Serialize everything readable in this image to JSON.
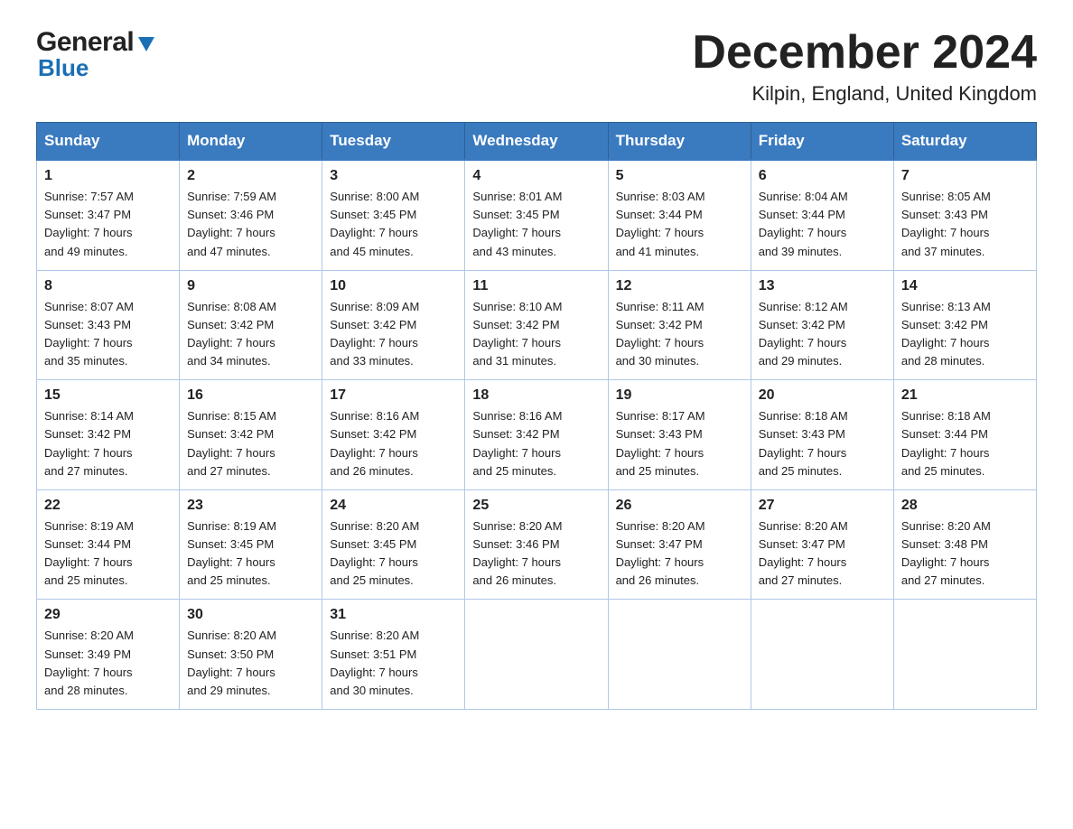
{
  "header": {
    "logo_general": "General",
    "logo_blue": "Blue",
    "title": "December 2024",
    "subtitle": "Kilpin, England, United Kingdom"
  },
  "days_of_week": [
    "Sunday",
    "Monday",
    "Tuesday",
    "Wednesday",
    "Thursday",
    "Friday",
    "Saturday"
  ],
  "weeks": [
    [
      {
        "num": "1",
        "sunrise": "7:57 AM",
        "sunset": "3:47 PM",
        "daylight": "7 hours and 49 minutes."
      },
      {
        "num": "2",
        "sunrise": "7:59 AM",
        "sunset": "3:46 PM",
        "daylight": "7 hours and 47 minutes."
      },
      {
        "num": "3",
        "sunrise": "8:00 AM",
        "sunset": "3:45 PM",
        "daylight": "7 hours and 45 minutes."
      },
      {
        "num": "4",
        "sunrise": "8:01 AM",
        "sunset": "3:45 PM",
        "daylight": "7 hours and 43 minutes."
      },
      {
        "num": "5",
        "sunrise": "8:03 AM",
        "sunset": "3:44 PM",
        "daylight": "7 hours and 41 minutes."
      },
      {
        "num": "6",
        "sunrise": "8:04 AM",
        "sunset": "3:44 PM",
        "daylight": "7 hours and 39 minutes."
      },
      {
        "num": "7",
        "sunrise": "8:05 AM",
        "sunset": "3:43 PM",
        "daylight": "7 hours and 37 minutes."
      }
    ],
    [
      {
        "num": "8",
        "sunrise": "8:07 AM",
        "sunset": "3:43 PM",
        "daylight": "7 hours and 35 minutes."
      },
      {
        "num": "9",
        "sunrise": "8:08 AM",
        "sunset": "3:42 PM",
        "daylight": "7 hours and 34 minutes."
      },
      {
        "num": "10",
        "sunrise": "8:09 AM",
        "sunset": "3:42 PM",
        "daylight": "7 hours and 33 minutes."
      },
      {
        "num": "11",
        "sunrise": "8:10 AM",
        "sunset": "3:42 PM",
        "daylight": "7 hours and 31 minutes."
      },
      {
        "num": "12",
        "sunrise": "8:11 AM",
        "sunset": "3:42 PM",
        "daylight": "7 hours and 30 minutes."
      },
      {
        "num": "13",
        "sunrise": "8:12 AM",
        "sunset": "3:42 PM",
        "daylight": "7 hours and 29 minutes."
      },
      {
        "num": "14",
        "sunrise": "8:13 AM",
        "sunset": "3:42 PM",
        "daylight": "7 hours and 28 minutes."
      }
    ],
    [
      {
        "num": "15",
        "sunrise": "8:14 AM",
        "sunset": "3:42 PM",
        "daylight": "7 hours and 27 minutes."
      },
      {
        "num": "16",
        "sunrise": "8:15 AM",
        "sunset": "3:42 PM",
        "daylight": "7 hours and 27 minutes."
      },
      {
        "num": "17",
        "sunrise": "8:16 AM",
        "sunset": "3:42 PM",
        "daylight": "7 hours and 26 minutes."
      },
      {
        "num": "18",
        "sunrise": "8:16 AM",
        "sunset": "3:42 PM",
        "daylight": "7 hours and 25 minutes."
      },
      {
        "num": "19",
        "sunrise": "8:17 AM",
        "sunset": "3:43 PM",
        "daylight": "7 hours and 25 minutes."
      },
      {
        "num": "20",
        "sunrise": "8:18 AM",
        "sunset": "3:43 PM",
        "daylight": "7 hours and 25 minutes."
      },
      {
        "num": "21",
        "sunrise": "8:18 AM",
        "sunset": "3:44 PM",
        "daylight": "7 hours and 25 minutes."
      }
    ],
    [
      {
        "num": "22",
        "sunrise": "8:19 AM",
        "sunset": "3:44 PM",
        "daylight": "7 hours and 25 minutes."
      },
      {
        "num": "23",
        "sunrise": "8:19 AM",
        "sunset": "3:45 PM",
        "daylight": "7 hours and 25 minutes."
      },
      {
        "num": "24",
        "sunrise": "8:20 AM",
        "sunset": "3:45 PM",
        "daylight": "7 hours and 25 minutes."
      },
      {
        "num": "25",
        "sunrise": "8:20 AM",
        "sunset": "3:46 PM",
        "daylight": "7 hours and 26 minutes."
      },
      {
        "num": "26",
        "sunrise": "8:20 AM",
        "sunset": "3:47 PM",
        "daylight": "7 hours and 26 minutes."
      },
      {
        "num": "27",
        "sunrise": "8:20 AM",
        "sunset": "3:47 PM",
        "daylight": "7 hours and 27 minutes."
      },
      {
        "num": "28",
        "sunrise": "8:20 AM",
        "sunset": "3:48 PM",
        "daylight": "7 hours and 27 minutes."
      }
    ],
    [
      {
        "num": "29",
        "sunrise": "8:20 AM",
        "sunset": "3:49 PM",
        "daylight": "7 hours and 28 minutes."
      },
      {
        "num": "30",
        "sunrise": "8:20 AM",
        "sunset": "3:50 PM",
        "daylight": "7 hours and 29 minutes."
      },
      {
        "num": "31",
        "sunrise": "8:20 AM",
        "sunset": "3:51 PM",
        "daylight": "7 hours and 30 minutes."
      },
      null,
      null,
      null,
      null
    ]
  ],
  "labels": {
    "sunrise": "Sunrise:",
    "sunset": "Sunset:",
    "daylight": "Daylight:"
  },
  "colors": {
    "header_bg": "#3a7abf",
    "header_text": "#ffffff",
    "border": "#b0c8e8",
    "accent": "#1a6fb5"
  }
}
